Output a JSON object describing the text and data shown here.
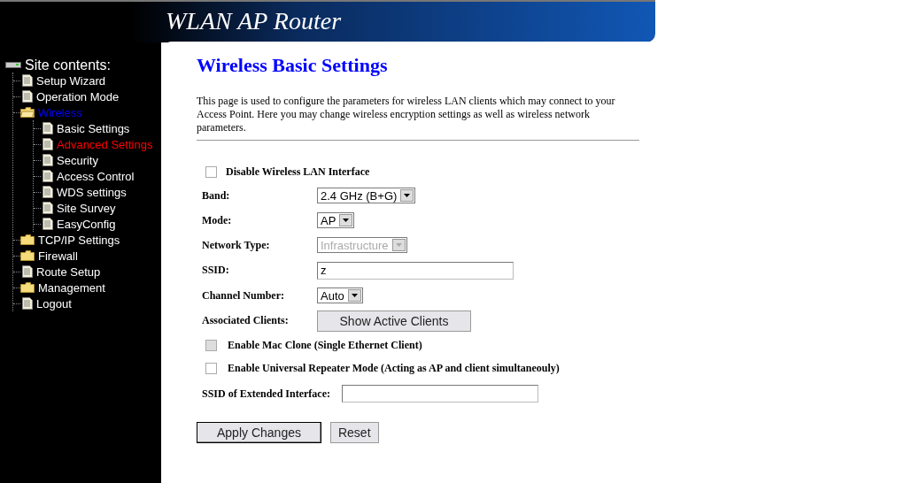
{
  "header": {
    "title": "WLAN AP Router"
  },
  "sidebar": {
    "title": "Site contents:",
    "items": [
      {
        "label": "Setup Wizard",
        "kind": "page",
        "color": "#ffffff"
      },
      {
        "label": "Operation Mode",
        "kind": "page",
        "color": "#ffffff"
      },
      {
        "label": "Wireless",
        "kind": "folder",
        "expanded": true,
        "color": "#0000ff",
        "children": [
          {
            "label": "Basic Settings",
            "kind": "page",
            "color": "#ffffff"
          },
          {
            "label": "Advanced Settings",
            "kind": "page",
            "color": "#ff0000"
          },
          {
            "label": "Security",
            "kind": "page",
            "color": "#ffffff"
          },
          {
            "label": "Access Control",
            "kind": "page",
            "color": "#ffffff"
          },
          {
            "label": "WDS settings",
            "kind": "page",
            "color": "#ffffff"
          },
          {
            "label": "Site Survey",
            "kind": "page",
            "color": "#ffffff"
          },
          {
            "label": "EasyConfig",
            "kind": "page",
            "color": "#ffffff"
          }
        ]
      },
      {
        "label": "TCP/IP Settings",
        "kind": "folder",
        "expanded": false,
        "color": "#ffffff"
      },
      {
        "label": "Firewall",
        "kind": "folder",
        "expanded": false,
        "color": "#ffffff"
      },
      {
        "label": "Route Setup",
        "kind": "page",
        "color": "#ffffff"
      },
      {
        "label": "Management",
        "kind": "folder",
        "expanded": false,
        "color": "#ffffff"
      },
      {
        "label": "Logout",
        "kind": "page",
        "color": "#ffffff"
      }
    ]
  },
  "page": {
    "title": "Wireless Basic Settings",
    "description": "This page is used to configure the parameters for wireless LAN clients which may connect to your Access Point. Here you may change wireless encryption settings as well as wireless network parameters."
  },
  "form": [
    {
      "kind": "checkbox",
      "label": "Disable Wireless LAN Interface",
      "checked": false,
      "disabled": false
    },
    {
      "kind": "select",
      "label": "Band:",
      "value": "2.4 GHz (B+G)",
      "disabled": false
    },
    {
      "kind": "select",
      "label": "Mode:",
      "value": "AP",
      "disabled": false
    },
    {
      "kind": "select",
      "label": "Network Type:",
      "value": "Infrastructure",
      "disabled": true
    },
    {
      "kind": "text",
      "label": "SSID:",
      "value": "z"
    },
    {
      "kind": "select",
      "label": "Channel Number:",
      "value": "Auto",
      "disabled": false
    },
    {
      "kind": "button",
      "label": "Associated Clients:",
      "value": "Show Active Clients"
    },
    {
      "kind": "checkbox",
      "label": "Enable Mac Clone (Single Ethernet Client)",
      "checked": false,
      "disabled": true
    },
    {
      "kind": "checkbox",
      "label": "Enable Universal Repeater Mode (Acting as AP and client simultaneouly)",
      "checked": false,
      "disabled": false
    },
    {
      "kind": "text",
      "label": "SSID of Extended Interface:"
    }
  ],
  "buttons": [
    {
      "label": "Apply Changes",
      "default": true
    },
    {
      "label": "Reset",
      "default": false
    }
  ]
}
